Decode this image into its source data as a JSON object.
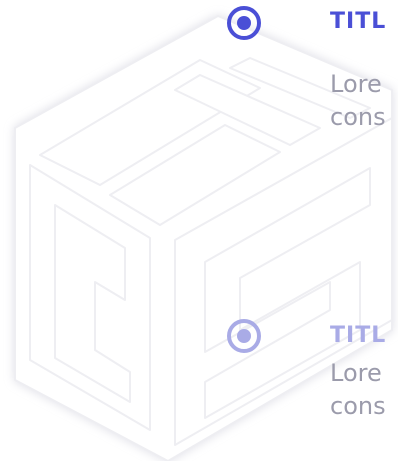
{
  "items": [
    {
      "state": "active",
      "title": "TITL",
      "body_line1": "Lore",
      "body_line2": "cons"
    },
    {
      "state": "inactive",
      "title": "TITL",
      "body_line1": "Lore",
      "body_line2": "cons"
    }
  ],
  "colors": {
    "accent_active": "#4a4fd6",
    "accent_inactive": "#a9abe6",
    "body_text": "#9b9bab",
    "watermark": "#f3f3f5"
  },
  "watermark": {
    "icon": "cube-logo-icon"
  }
}
